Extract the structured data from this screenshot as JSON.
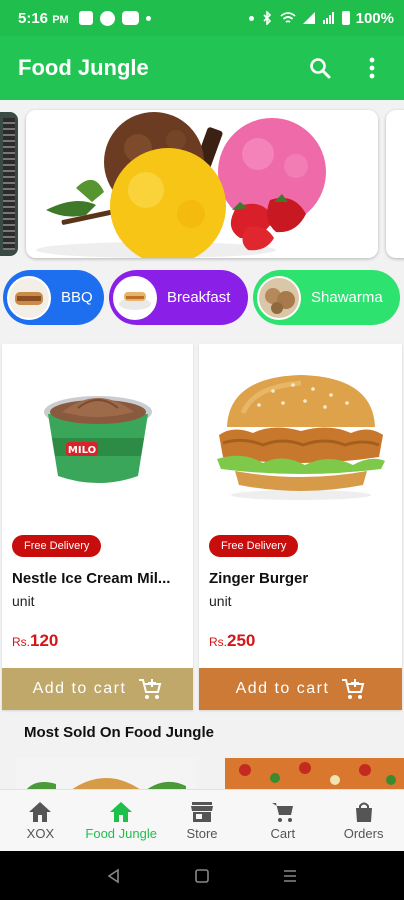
{
  "status_bar": {
    "time": "5:16",
    "ampm": "PM",
    "battery": "100%"
  },
  "app_bar": {
    "title": "Food Jungle"
  },
  "categories": [
    {
      "label": "BBQ",
      "color": "#1e6ff0"
    },
    {
      "label": "Breakfast",
      "color": "#8a1fe8"
    },
    {
      "label": "Shawarma",
      "color": "#2de26f"
    }
  ],
  "products": [
    {
      "badge": "Free Delivery",
      "name": "Nestle Ice Cream Mil...",
      "unit": "unit",
      "currency": "Rs.",
      "price": "120",
      "button": "Add to cart",
      "button_color": "#bfa86a"
    },
    {
      "badge": "Free Delivery",
      "name": "Zinger Burger",
      "unit": "unit",
      "currency": "Rs.",
      "price": "250",
      "button": "Add to cart",
      "button_color": "#cc7a35"
    }
  ],
  "section": {
    "most_sold_title": "Most Sold On Food Jungle"
  },
  "bottom_nav": [
    {
      "label": "XOX",
      "icon": "home-icon"
    },
    {
      "label": "Food Jungle",
      "icon": "home-icon",
      "active": true
    },
    {
      "label": "Store",
      "icon": "store-icon"
    },
    {
      "label": "Cart",
      "icon": "cart-icon"
    },
    {
      "label": "Orders",
      "icon": "bag-icon"
    }
  ],
  "colors": {
    "primary": "#22c553",
    "price": "#d41616",
    "badge": "#c80d0d"
  }
}
